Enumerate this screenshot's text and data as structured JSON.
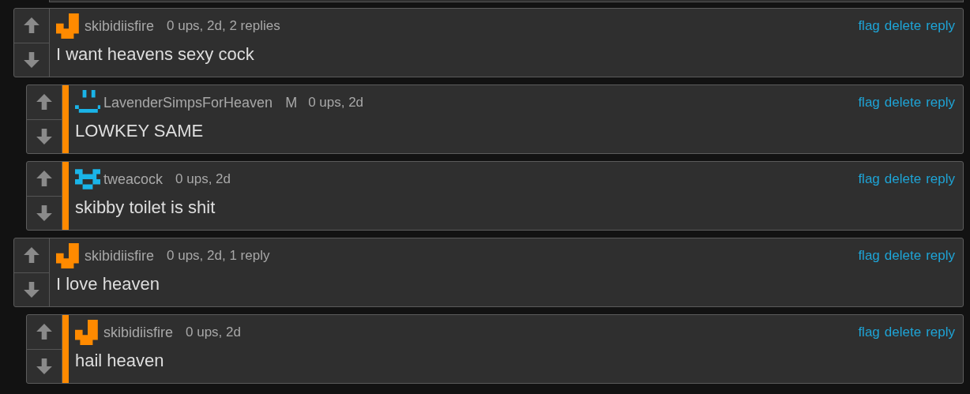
{
  "comments": [
    {
      "avatar": {
        "kind": "hook",
        "color": "#ff8a00"
      },
      "username": "skibidiisfire",
      "meta": "0 ups, 2d, 2 replies",
      "body": "I want heavens sexy cock",
      "actions": [
        "flag",
        "delete",
        "reply"
      ],
      "children": [
        {
          "avatar": {
            "kind": "smile",
            "color": "#1ab4e8"
          },
          "username": "LavenderSimpsForHeaven",
          "badge": "M",
          "meta": "0 ups, 2d",
          "body": "LOWKEY SAME",
          "actions": [
            "flag",
            "delete",
            "reply"
          ]
        },
        {
          "avatar": {
            "kind": "checker",
            "color": "#1ab4e8"
          },
          "username": "tweacock",
          "meta": "0 ups, 2d",
          "body": "skibby toilet is shit",
          "actions": [
            "flag",
            "delete",
            "reply"
          ]
        }
      ]
    },
    {
      "avatar": {
        "kind": "hook",
        "color": "#ff8a00"
      },
      "username": "skibidiisfire",
      "meta": "0 ups, 2d, 1 reply",
      "body": "I love heaven",
      "actions": [
        "flag",
        "delete",
        "reply"
      ],
      "children": [
        {
          "avatar": {
            "kind": "hook",
            "color": "#ff8a00"
          },
          "username": "skibidiisfire",
          "meta": "0 ups, 2d",
          "body": "hail heaven",
          "actions": [
            "flag",
            "delete",
            "reply"
          ]
        }
      ]
    }
  ]
}
